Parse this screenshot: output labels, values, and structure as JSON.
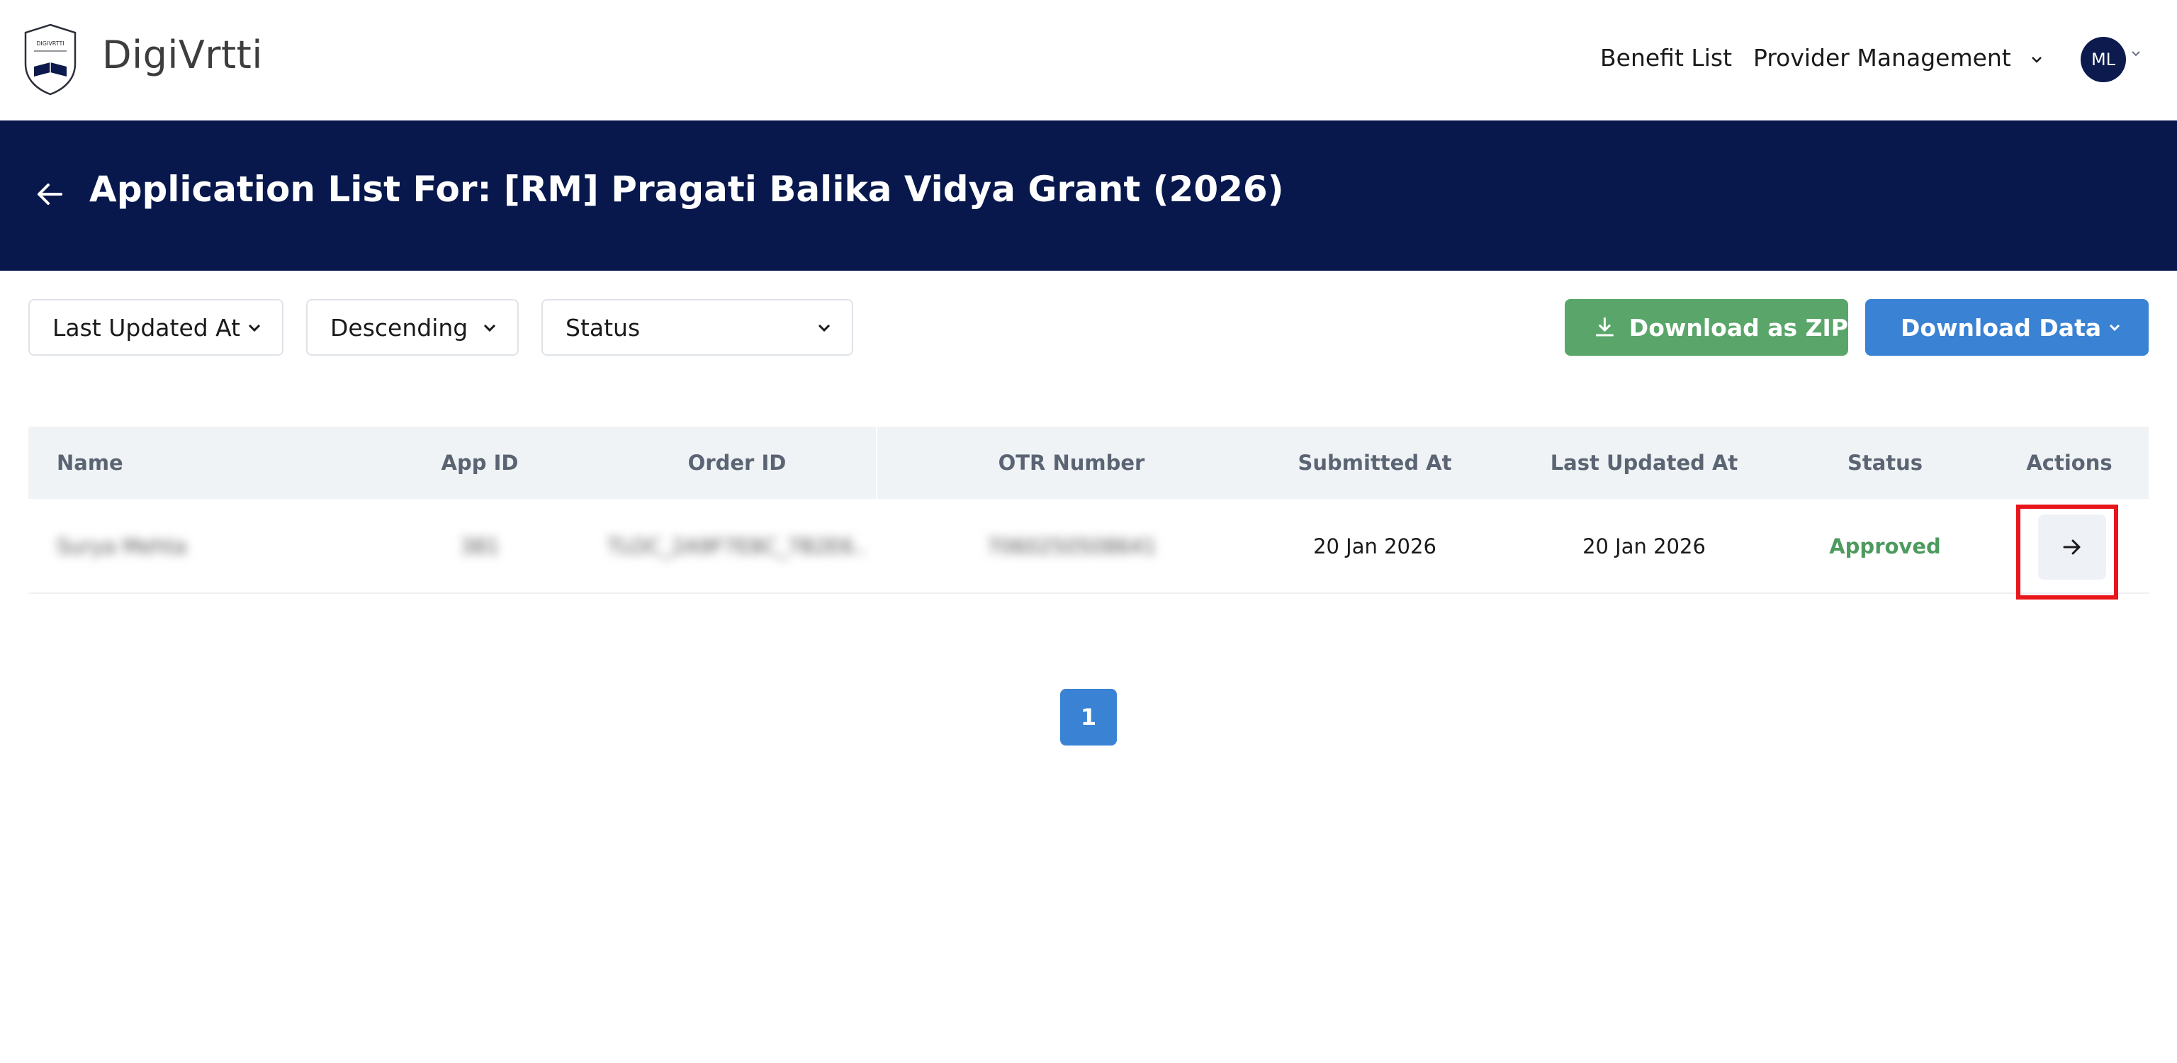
{
  "header": {
    "logo_text": "DIGIVRTTI",
    "brand": "DigiVrtti",
    "nav": {
      "benefit_list": "Benefit List",
      "provider_management": "Provider Management"
    },
    "avatar_initials": "ML"
  },
  "banner": {
    "title": "Application List For: [RM] Pragati Balika Vidya Grant (2026)"
  },
  "filters": {
    "sort_field": "Last Updated At",
    "sort_order": "Descending",
    "status": "Status"
  },
  "actions": {
    "download_zip": "Download as ZIP",
    "download_data": "Download Data"
  },
  "table": {
    "columns": [
      "Name",
      "App ID",
      "Order ID",
      "OTR Number",
      "Submitted At",
      "Last Updated At",
      "Status",
      "Actions"
    ],
    "rows": [
      {
        "name": "Surya Mehta",
        "app_id": "381",
        "order_id": "TLOC_2A9F7E8C_7B2E6..",
        "otr_number": "7060250508641",
        "submitted_at": "20 Jan 2026",
        "last_updated_at": "20 Jan 2026",
        "status": "Approved"
      }
    ]
  },
  "pagination": {
    "current_page": "1"
  },
  "colors": {
    "banner": "#08184d",
    "zip_button": "#5aa66a",
    "data_button": "#3a82d4",
    "approved": "#4d9a5e",
    "highlight": "#e8161b"
  }
}
